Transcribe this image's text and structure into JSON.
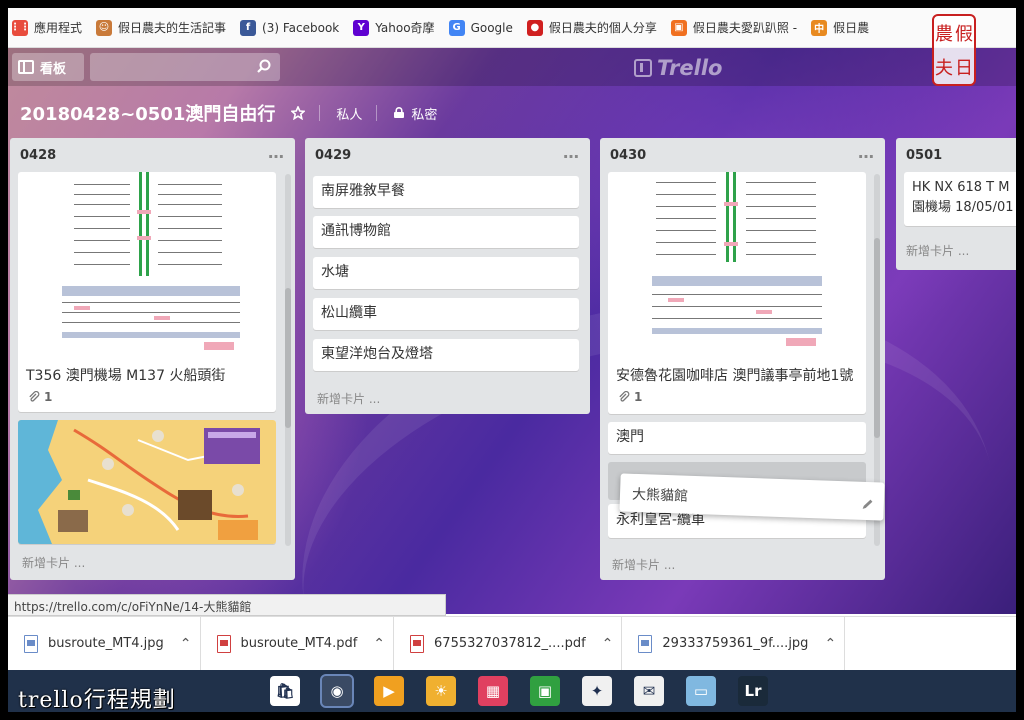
{
  "bookmarks": [
    {
      "label": "應用程式",
      "icon": "apps-grid-icon",
      "color": "#e84c3d"
    },
    {
      "label": "假日農夫的生活記事",
      "icon": "farmer-avatar-icon",
      "color": "#c97a3a"
    },
    {
      "label": "(3) Facebook",
      "icon": "facebook-icon",
      "color": "#3b5998"
    },
    {
      "label": "Yahoo奇摩",
      "icon": "yahoo-icon",
      "color": "#5f01d1"
    },
    {
      "label": "Google",
      "icon": "google-icon",
      "color": "#4285f4"
    },
    {
      "label": "假日農夫的個人分享",
      "icon": "pin-icon",
      "color": "#d02020"
    },
    {
      "label": "假日農夫愛趴趴照 - ",
      "icon": "bookmark-orange-icon",
      "color": "#f07020"
    },
    {
      "label": "假日農",
      "icon": "bookmark-zhong-icon",
      "color": "#e88a20"
    }
  ],
  "header": {
    "boards_label": "看板",
    "search_value": "",
    "logo_text": "Trello"
  },
  "board": {
    "title": "20180428~0501澳門自由行",
    "visibility_private": "私人",
    "visibility_secret": "私密"
  },
  "lists": [
    {
      "name": "0428",
      "cards": [
        {
          "text": "T356 澳門機場 M137 火船頭街",
          "attachments": "1"
        }
      ],
      "add_card": "新增卡片 ..."
    },
    {
      "name": "0429",
      "cards": [
        {
          "text": "南屏雅敘早餐"
        },
        {
          "text": "通訊博物館"
        },
        {
          "text": "水塘"
        },
        {
          "text": "松山纜車"
        },
        {
          "text": "東望洋炮台及燈塔"
        }
      ],
      "add_card": "新增卡片 ..."
    },
    {
      "name": "0430",
      "cards": [
        {
          "text": "安德魯花園咖啡店 澳門議事亭前地1號",
          "attachments": "1"
        },
        {
          "text": "澳門 "
        },
        {
          "text": "永利皇宮-纜車"
        }
      ],
      "dragging_card": "大熊貓館",
      "add_card": "新增卡片 ..."
    },
    {
      "name": "0501",
      "cards": [
        {
          "text": "HK NX 618 T M"
        },
        {
          "text": "園機場 18/05/01"
        }
      ],
      "add_card": "新增卡片 ..."
    }
  ],
  "status_url": "https://trello.com/c/oFiYnNe/14-大熊貓館",
  "downloads": [
    {
      "name": "busroute_MT4.jpg",
      "type": "jpg"
    },
    {
      "name": "busroute_MT4.pdf",
      "type": "pdf"
    },
    {
      "name": "6755327037812_....pdf",
      "type": "pdf"
    },
    {
      "name": "29333759361_9f....jpg",
      "type": "jpg"
    }
  ],
  "taskbar_apps": [
    "store-icon",
    "chrome-icon",
    "media-player-icon",
    "weather-icon",
    "photo-icon",
    "image-viewer-icon",
    "paint-icon",
    "mail-icon",
    "notes-icon",
    "lightroom-icon"
  ],
  "caption": "trello行程規劃",
  "stamp": [
    "假",
    "農",
    "日",
    "夫"
  ],
  "colors": {
    "list_bg": "#e2e4e6",
    "taskbar": "#20314a",
    "stamp_red": "#c82020"
  }
}
